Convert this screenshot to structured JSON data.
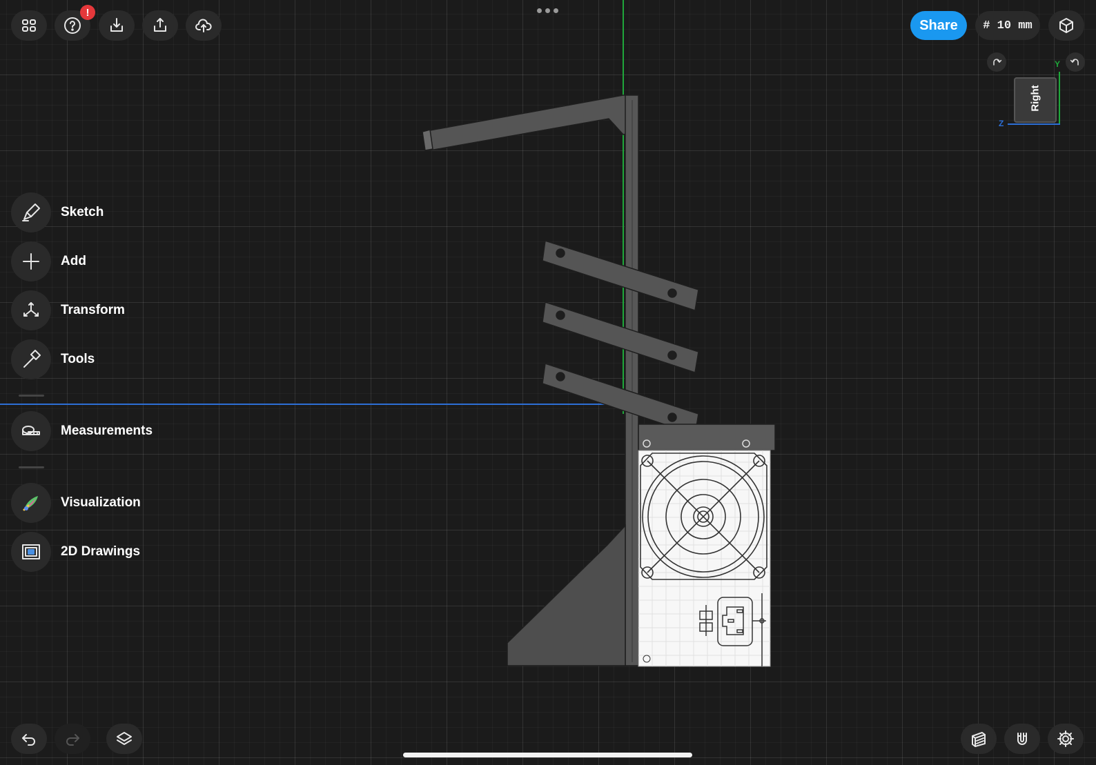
{
  "toolbar": {
    "notification_badge": "!",
    "share_label": "Share",
    "grid_size": "# 10 mm"
  },
  "view_cube": {
    "face_label": "Right",
    "axis_y": "Y",
    "axis_z": "Z"
  },
  "side_menu": {
    "sketch": "Sketch",
    "add": "Add",
    "transform": "Transform",
    "tools": "Tools",
    "measurements": "Measurements",
    "visualization": "Visualization",
    "drawings": "2D Drawings"
  },
  "icons": [
    "grid-menu-icon",
    "help-icon",
    "import-icon",
    "export-icon",
    "cloud-upload-icon",
    "more-icon",
    "view-cube-icon",
    "rotate-right-icon",
    "rotate-left-icon",
    "sketch-icon",
    "add-icon",
    "transform-icon",
    "tools-icon",
    "measurements-icon",
    "visualization-icon",
    "drawings-icon",
    "undo-icon",
    "redo-icon",
    "layers-icon",
    "section-view-icon",
    "snap-magnet-icon",
    "settings-icon"
  ],
  "colors": {
    "background": "#1b1b1b",
    "share_button": "#1a98f0",
    "badge": "#e5383b",
    "y_axis": "#1fa83a",
    "z_axis": "#2d6fd6"
  }
}
